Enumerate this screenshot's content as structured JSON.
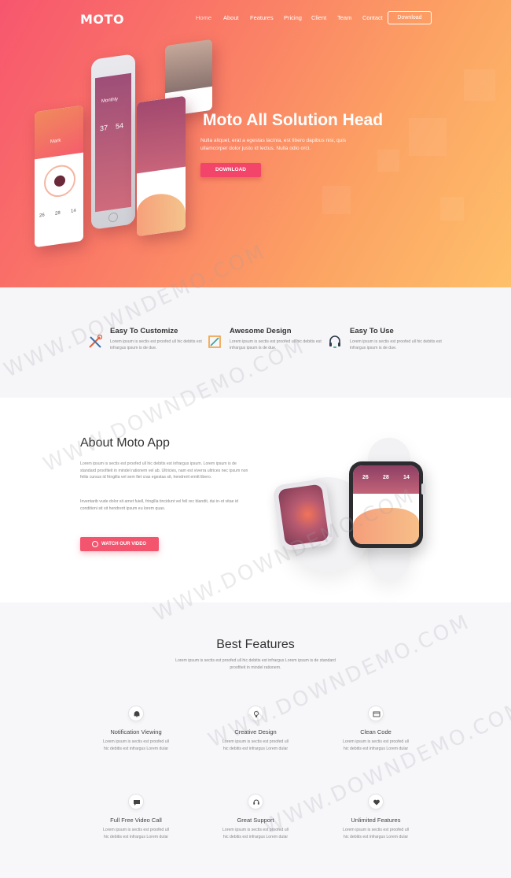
{
  "nav": {
    "logo": "MOTO",
    "items": [
      "Home",
      "About",
      "Features",
      "Pricing",
      "Client",
      "Team",
      "Contact"
    ],
    "download": "Download"
  },
  "hero": {
    "title": "Moto All Solution Head",
    "text": "Nulla aliquet, erat a egestas lacinia, est libero dapibus nisi, quis ullamcorper dolor justo id lectus. Nulla odio orci.",
    "button": "DOWNLOAD",
    "phone": {
      "card1_title": "Mark",
      "monthly": "Monthly",
      "stats": [
        "37",
        "54"
      ],
      "card1_stats": [
        "26",
        "28",
        "14"
      ]
    }
  },
  "features": [
    {
      "title": "Easy To Customize",
      "text": "Lorem ipsum is sectis est proofed ull hic debitis est infrargus ipsum is de due."
    },
    {
      "title": "Awesome Design",
      "text": "Lorem ipsum is sectis est proofed ull hic debitis est infrargus ipsum is de due."
    },
    {
      "title": "Easy To Use",
      "text": "Lorem ipsum is sectis est proofed ull hic debitis est infrargus ipsum is de due."
    }
  ],
  "about": {
    "title": "About Moto App",
    "p1": "Lorem ipsum is sectis est proofed ull hic debitis est infrargus ipsum. Lorem ipsum is de standard proofiteit in mindel rationem vel ab. Ultricies, nam est viverra ultrices nec ipsum non feliis cursus id fringilla vel sem fiet cras egestas sit, hendrerit emitt libero.",
    "p2": "Inventarib vude dolor sit amet fuiell, fringilla tincidunt vel fell rec blandit, dui in-ot vitae id conditioni sit sit hendrerit ipsum eu lorem quas.",
    "button": "WATCH OUR VIDEO",
    "watch_stats": [
      "26",
      "28",
      "14"
    ]
  },
  "best": {
    "title": "Best Features",
    "subtitle": "Lorem ipsum is sectis est proofed ull hic debitis est infrargus Lorem ipsum is de standard proofiteit in mindel rationem.",
    "items": [
      {
        "title": "Notification Viewing",
        "text": "Lorem ipsum is sectis est proofed ull hic debitis est infrargus Lorem dular",
        "icon": "bell-icon"
      },
      {
        "title": "Creative Design",
        "text": "Lorem ipsum is sectis est proofed ull hic debitis est infrargus Lorem dular",
        "icon": "bulb-icon"
      },
      {
        "title": "Clean Code",
        "text": "Lorem ipsum is sectis est proofed ull hic debitis est infrargus Lorem dular",
        "icon": "code-icon"
      },
      {
        "title": "Full Free Video Call",
        "text": "Lorem ipsum is sectis est proofed ull hic debitis est infrargus Lorem dular",
        "icon": "video-chat-icon"
      },
      {
        "title": "Great Support",
        "text": "Lorem ipsum is sectis est proofed ull hic debitis est infrargus Lorem dular",
        "icon": "support-icon"
      },
      {
        "title": "Unlimited Features",
        "text": "Lorem ipsum is sectis est proofed ull hic debitis est infrargus Lorem dular",
        "icon": "heart-icon"
      }
    ]
  },
  "watermark": "WWW.DOWNDEMO.COM",
  "colors": {
    "accent": "#f3546e",
    "hero_start": "#f7566e",
    "hero_end": "#fec06a"
  }
}
